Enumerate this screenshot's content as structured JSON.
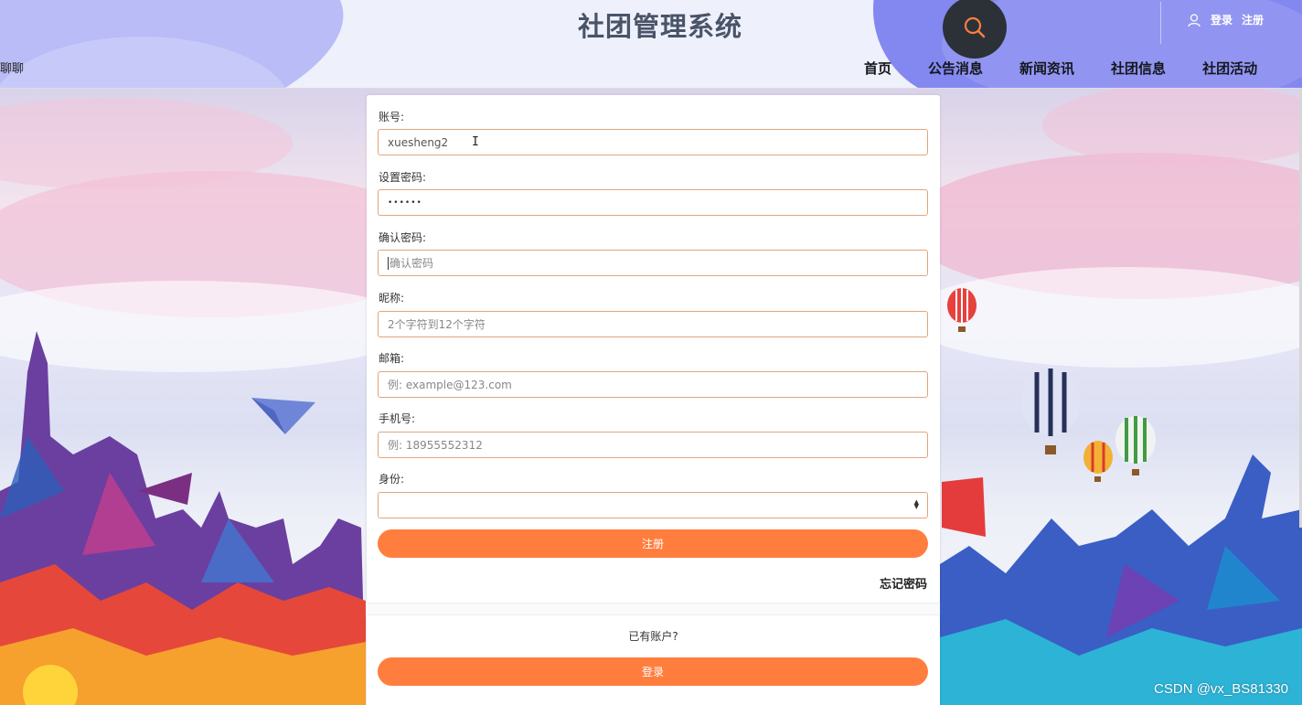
{
  "header": {
    "site_title": "社团管理系统",
    "left_fragment": "聊聊",
    "login_label": "登录",
    "register_label": "注册",
    "nav": [
      "首页",
      "公告消息",
      "新闻资讯",
      "社团信息",
      "社团活动"
    ],
    "accent_color": "#8388f0"
  },
  "form": {
    "account_label": "账号:",
    "account_value": "xuesheng2",
    "password_label": "设置密码:",
    "password_value": "••••••",
    "confirm_label": "确认密码:",
    "confirm_placeholder": "确认密码",
    "nickname_label": "昵称:",
    "nickname_placeholder": "2个字符到12个字符",
    "email_label": "邮箱:",
    "email_placeholder": "例: example@123.com",
    "phone_label": "手机号:",
    "phone_placeholder": "例: 18955552312",
    "identity_label": "身份:",
    "identity_value": "",
    "register_button": "注册",
    "forgot_password": "忘记密码",
    "button_color": "#ff7e3e"
  },
  "login_panel": {
    "have_account": "已有账户?",
    "login_button": "登录"
  },
  "watermark": "CSDN @vx_BS81330"
}
